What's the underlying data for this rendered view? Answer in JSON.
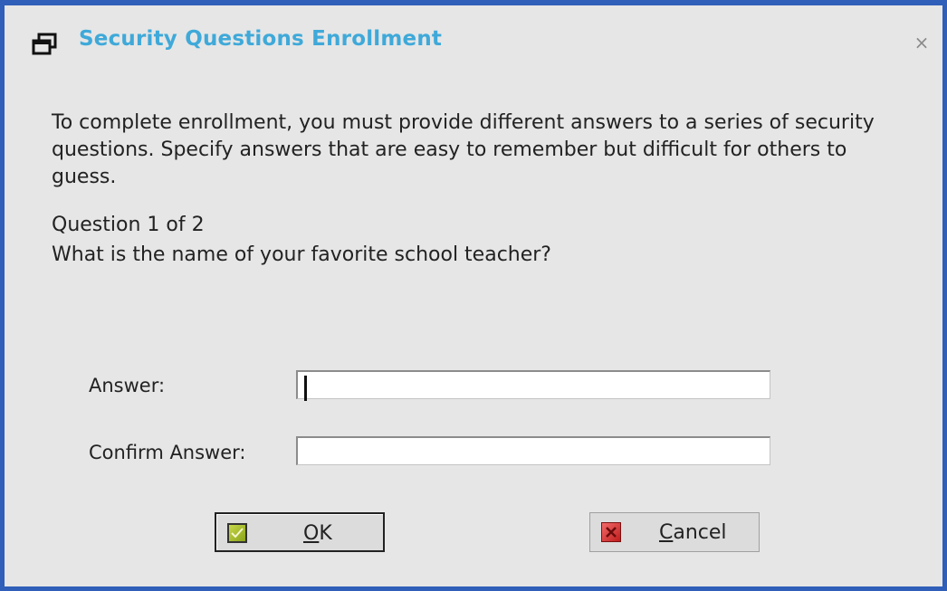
{
  "window": {
    "title": "Security Questions Enrollment",
    "icon": "restore-window-icon",
    "close_symbol": "×"
  },
  "intro_text": "To complete enrollment, you must provide different answers to a series of security questions. Specify answers that are easy to remember but difficult for others to guess.",
  "question": {
    "counter": "Question 1 of 2",
    "text": "What is the name of your favorite school teacher?"
  },
  "form": {
    "answer_label": "Answer:",
    "answer_value": "",
    "confirm_label": "Confirm Answer:",
    "confirm_value": ""
  },
  "buttons": {
    "ok": {
      "mnemonic": "O",
      "rest": "K",
      "icon": "check-icon"
    },
    "cancel": {
      "mnemonic": "C",
      "rest": "ancel",
      "icon": "x-icon"
    }
  },
  "colors": {
    "title": "#3fa9d9",
    "window_border": "#2f5fb8",
    "background": "#e6e6e6"
  }
}
